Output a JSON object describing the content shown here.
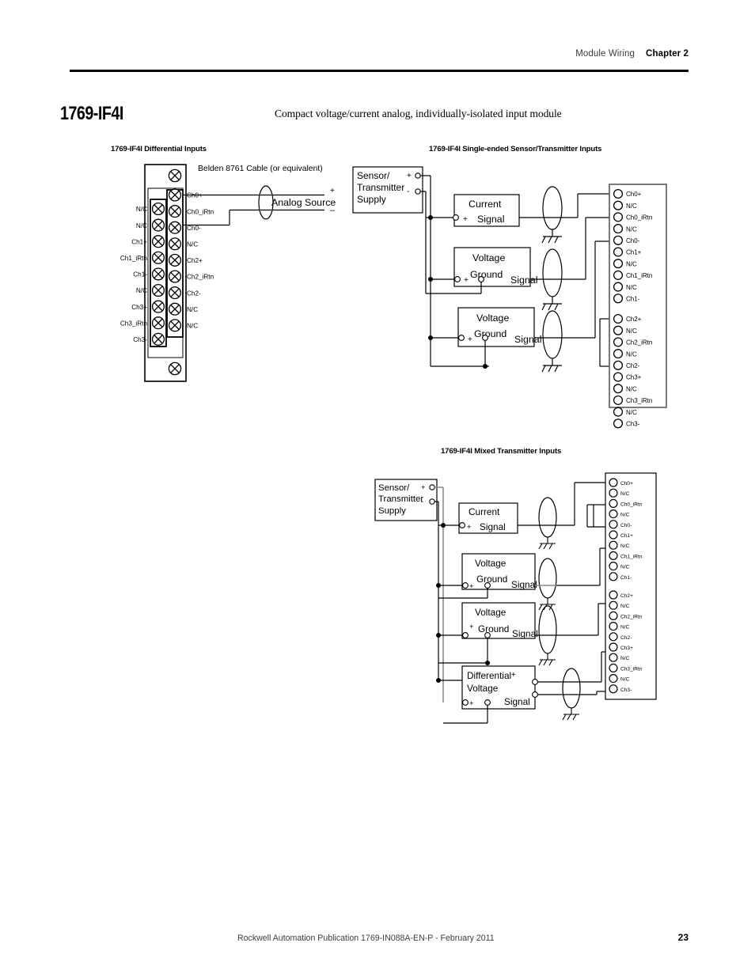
{
  "header": {
    "section": "Module Wiring",
    "chapter": "Chapter 2"
  },
  "title": "1769-IF4I",
  "subtitle": "Compact voltage/current analog, individually-isolated input module",
  "captions": {
    "differential": "1769-IF4I Differential Inputs",
    "single_ended": "1769-IF4I Single-ended Sensor/Transmitter Inputs",
    "mixed": "1769-IF4I Mixed Transmitter Inputs"
  },
  "diagram_differential": {
    "cable_label": "Belden 8761 Cable (or equivalent)",
    "source_label": "Analog Source",
    "source_plus": "+",
    "source_minus": "–",
    "left_terminals": [
      "N/C",
      "N/C",
      "Ch1+",
      "Ch1_iRtn",
      "Ch1-",
      "N/C",
      "Ch3+",
      "Ch3_iRtn",
      "Ch3-"
    ],
    "right_terminals": [
      "Ch0+",
      "Ch0_iRtn",
      "Ch0-",
      "N/C",
      "Ch2+",
      "Ch2_iRtn",
      "Ch2-",
      "N/C",
      "N/C"
    ]
  },
  "diagram_single_ended": {
    "supply_line1": "Sensor/",
    "supply_line2": "Transmitter",
    "supply_line3": "Supply",
    "supply_plus": "+",
    "supply_minus": "-",
    "devices": [
      {
        "title": "Current",
        "signal": "Signal",
        "plus": "+"
      },
      {
        "title": "Voltage",
        "ground": "Ground",
        "signal": "Signal",
        "plus": "+"
      },
      {
        "title": "Voltage",
        "ground": "Ground",
        "signal": "Signal",
        "plus": "+"
      }
    ],
    "terminals": [
      "Ch0+",
      "N/C",
      "Ch0_iRtn",
      "N/C",
      "Ch0-",
      "Ch1+",
      "N/C",
      "Ch1_iRtn",
      "N/C",
      "Ch1-",
      "Ch2+",
      "N/C",
      "Ch2_iRtn",
      "N/C",
      "Ch2-",
      "Ch3+",
      "N/C",
      "Ch3_iRtn",
      "N/C",
      "Ch3-"
    ]
  },
  "diagram_mixed": {
    "supply_line1": "Sensor/",
    "supply_line2": "Transmitter",
    "supply_line3": "Supply",
    "supply_plus": "+",
    "supply_minus": "-",
    "devices": [
      {
        "title": "Current",
        "signal": "Signal",
        "plus": "+"
      },
      {
        "title": "Voltage",
        "ground": "Ground",
        "signal": "Signal",
        "plus": "+"
      },
      {
        "title": "Voltage",
        "ground": "Ground",
        "signal": "Signal",
        "plus": "+"
      },
      {
        "title": "Differential",
        "title2": "Voltage",
        "signal": "Signal",
        "plus": "+",
        "term_plus": "+"
      }
    ],
    "terminals": [
      "Ch0+",
      "N/C",
      "Ch0_iRtn",
      "N/C",
      "Ch0-",
      "Ch1+",
      "N/C",
      "Ch1_iRtn",
      "N/C",
      "Ch1-",
      "Ch2+",
      "N/C",
      "Ch2_iRtn",
      "N/C",
      "Ch2-",
      "Ch3+",
      "N/C",
      "Ch3_iRtn",
      "N/C",
      "Ch3-"
    ]
  },
  "footer": {
    "publication": "Rockwell Automation Publication 1769-IN088A-EN-P - February 2011",
    "page": "23"
  }
}
